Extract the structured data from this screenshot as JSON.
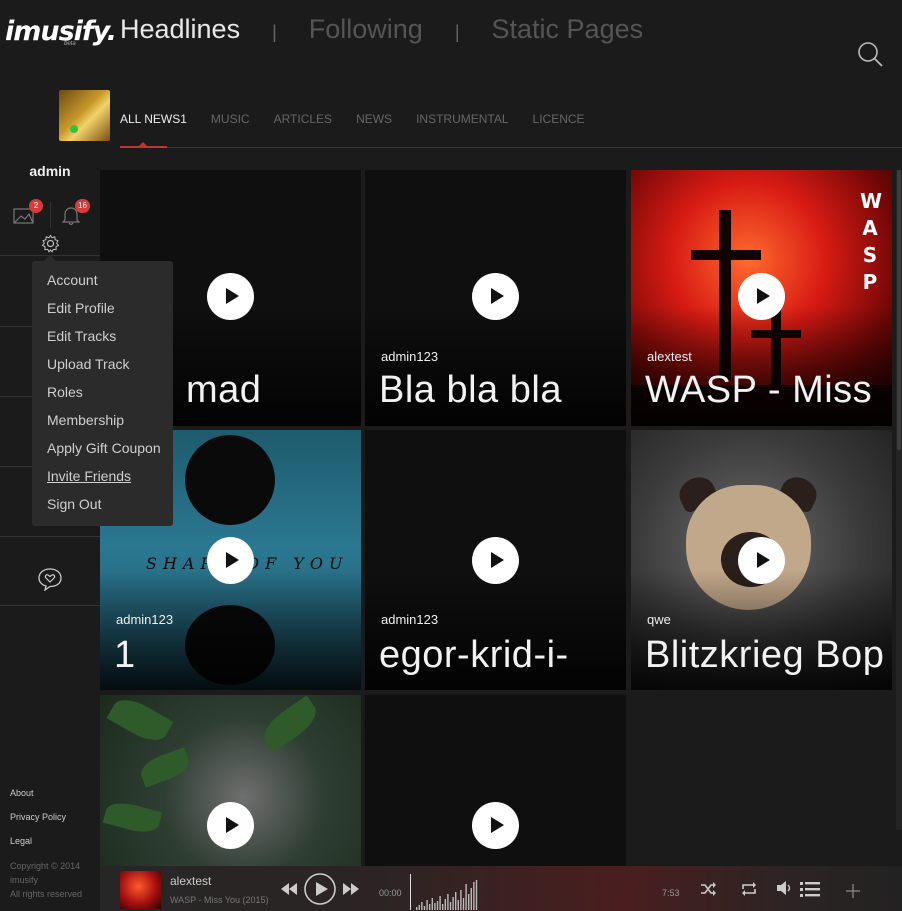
{
  "logo": {
    "text": "imusify.",
    "sub": "beta"
  },
  "topnav": [
    {
      "label": "Headlines",
      "active": true
    },
    {
      "label": "Following",
      "active": false
    },
    {
      "label": "Static Pages",
      "active": false
    }
  ],
  "categories": [
    {
      "label": "ALL NEWS1",
      "active": true
    },
    {
      "label": "MUSIC",
      "active": false
    },
    {
      "label": "ARTICLES",
      "active": false
    },
    {
      "label": "NEWS",
      "active": false
    },
    {
      "label": "INSTRUMENTAL",
      "active": false
    },
    {
      "label": "LICENCE",
      "active": false
    }
  ],
  "sidebar": {
    "username": "admin",
    "messages_count": "2",
    "notifications_count": "16",
    "footer_links": [
      "About",
      "Privacy Policy",
      "Legal"
    ],
    "copyright": [
      "Copyright © 2014",
      "imusify",
      "All rights reserved"
    ]
  },
  "dropdown": {
    "items": [
      "Account",
      "Edit Profile",
      "Edit Tracks",
      "Upload Track",
      "Roles",
      "Membership",
      "Apply Gift Coupon",
      "Invite Friends",
      "Sign Out"
    ]
  },
  "cards": [
    {
      "author": "",
      "title": "mad"
    },
    {
      "author": "admin123",
      "title": "Bla bla bla"
    },
    {
      "author": "alextest",
      "title": "WASP - Miss"
    },
    {
      "author": "admin123",
      "title": "1"
    },
    {
      "author": "admin123",
      "title": "egor-krid-i-"
    },
    {
      "author": "qwe",
      "title": "Blitzkrieg Bop"
    },
    {
      "author": "",
      "title": ""
    },
    {
      "author": "",
      "title": ""
    }
  ],
  "art": {
    "wasp_letters": [
      "W",
      "A",
      "S",
      "P"
    ],
    "shape_text": "SHAPE OF YOU"
  },
  "player": {
    "author": "alextest",
    "song": "WASP - Miss You (2015)",
    "time_current": "00:00",
    "time_total": "7:53"
  }
}
